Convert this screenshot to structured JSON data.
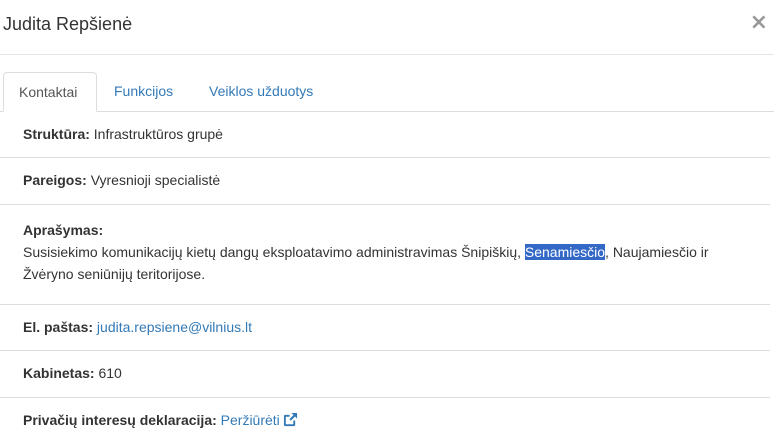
{
  "modal": {
    "title": "Judita Repšienė",
    "close_label": "×"
  },
  "tabs": [
    {
      "label": "Kontaktai",
      "active": true
    },
    {
      "label": "Funkcijos",
      "active": false
    },
    {
      "label": "Veiklos užduotys",
      "active": false
    }
  ],
  "fields": {
    "structure": {
      "label": "Struktūra:",
      "value": "Infrastruktūros grupė"
    },
    "position": {
      "label": "Pareigos:",
      "value": "Vyresnioji specialistė"
    },
    "description": {
      "label": "Aprašymas:",
      "text_before": "Susisiekimo komunikacijų kietų dangų eksploatavimo administravimas Šnipiškių, ",
      "text_selected": "Senamiesčio",
      "text_after": ", Naujamiesčio ir Žvėryno seniūnijų teritorijose."
    },
    "email": {
      "label": "El. paštas:",
      "value": "judita.repsiene@vilnius.lt"
    },
    "office": {
      "label": "Kabinetas:",
      "value": "610"
    },
    "declaration": {
      "label": "Privačių interesų deklaracija:",
      "link_text": "Peržiūrėti",
      "icon": "external-link-icon"
    }
  },
  "colors": {
    "link": "#337ab7",
    "selection": "#3368c6"
  }
}
